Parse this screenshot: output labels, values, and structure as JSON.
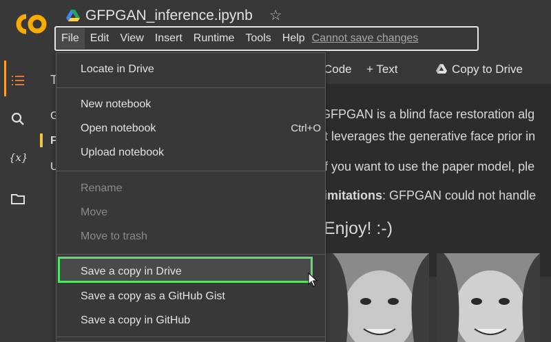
{
  "app": {
    "logo_text": "CO",
    "accent": "#f4a125"
  },
  "notebook": {
    "title": "GFPGAN_inference.ipynb",
    "star_icon": "star-outline"
  },
  "menubar": {
    "items": [
      "File",
      "Edit",
      "View",
      "Insert",
      "Runtime",
      "Tools",
      "Help"
    ],
    "active": "File",
    "status_link": "Cannot save changes"
  },
  "sidebar": {
    "icons": [
      "table-of-contents-icon",
      "search-icon",
      "variables-icon",
      "folder-icon"
    ],
    "variables_label": "{x}"
  },
  "toc": {
    "partial_labels": [
      "Ta",
      "G",
      "F",
      "U"
    ]
  },
  "toolbar": {
    "code_label": "Code",
    "text_label": "+ Text",
    "copy_to_drive_label": "Copy to Drive"
  },
  "text_cell": {
    "line1": "GFPGAN is a blind face restoration alg",
    "line2": "t leverages the generative face prior in",
    "line3": "f you want to use the paper model, ple",
    "line4_bold": "imitations",
    "line4_rest": ": GFPGAN could not handle",
    "enjoy": "Enjoy! :-)"
  },
  "file_menu": {
    "items": [
      {
        "label": "Locate in Drive",
        "shortcut": "",
        "disabled": false
      },
      {
        "label": "New notebook",
        "shortcut": "",
        "disabled": false
      },
      {
        "label": "Open notebook",
        "shortcut": "Ctrl+O",
        "disabled": false
      },
      {
        "label": "Upload notebook",
        "shortcut": "",
        "disabled": false
      },
      {
        "label": "Rename",
        "shortcut": "",
        "disabled": true
      },
      {
        "label": "Move",
        "shortcut": "",
        "disabled": true
      },
      {
        "label": "Move to trash",
        "shortcut": "",
        "disabled": true
      },
      {
        "label": "Save a copy in Drive",
        "shortcut": "",
        "disabled": false,
        "highlighted": true
      },
      {
        "label": "Save a copy as a GitHub Gist",
        "shortcut": "",
        "disabled": false
      },
      {
        "label": "Save a copy in GitHub",
        "shortcut": "",
        "disabled": false
      }
    ],
    "highlight_color": "#57e36b"
  }
}
